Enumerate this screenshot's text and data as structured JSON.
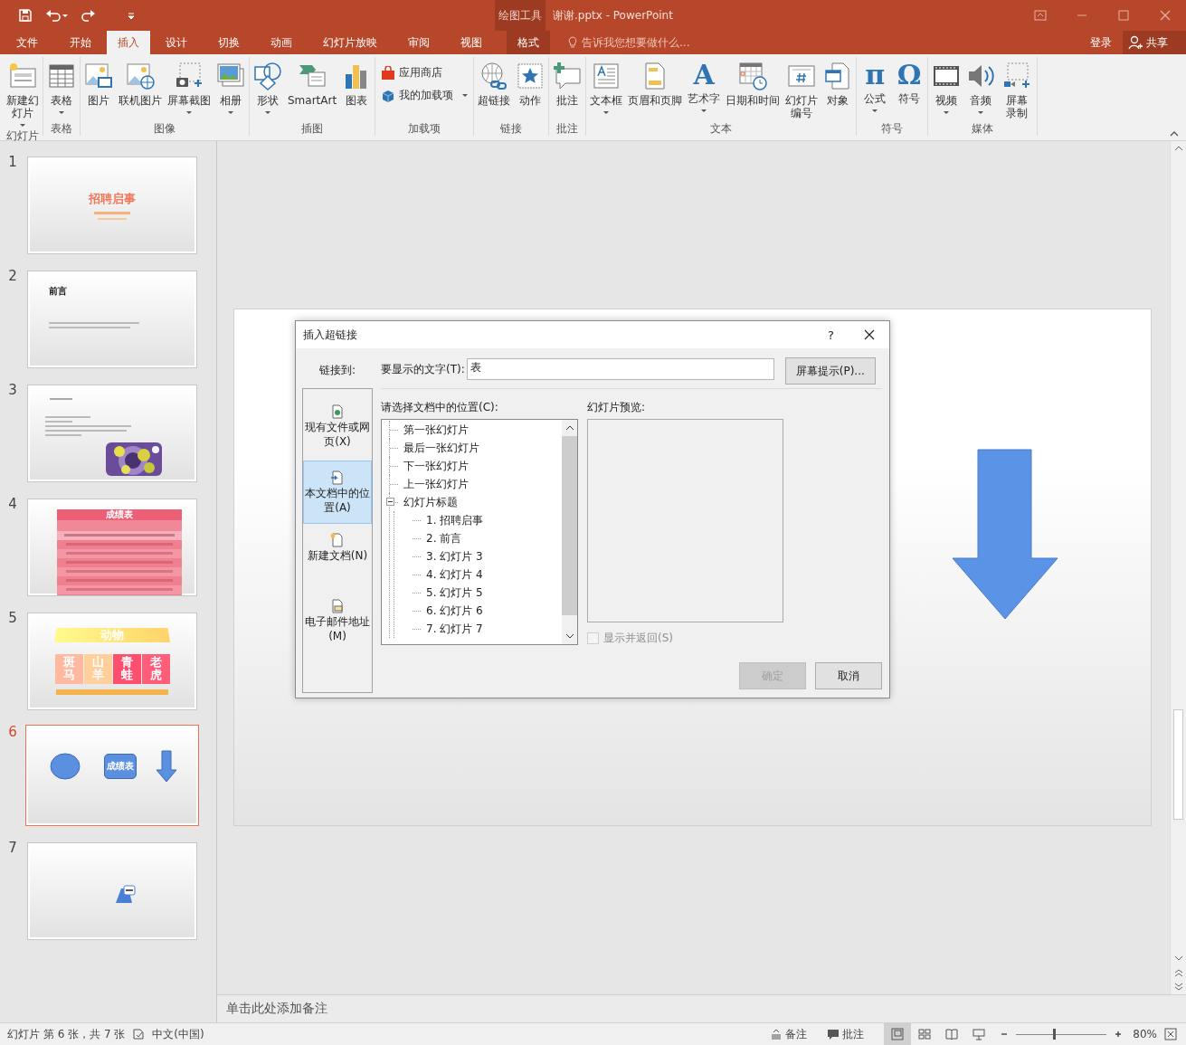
{
  "window": {
    "context_group": "绘图工具",
    "title": "谢谢.pptx - PowerPoint"
  },
  "tabs": [
    {
      "label": "文件",
      "kind": "file",
      "selected": false
    },
    {
      "label": "开始",
      "kind": "normal",
      "selected": false
    },
    {
      "label": "插入",
      "kind": "normal",
      "selected": true
    },
    {
      "label": "设计",
      "kind": "normal",
      "selected": false
    },
    {
      "label": "切换",
      "kind": "normal",
      "selected": false
    },
    {
      "label": "动画",
      "kind": "normal",
      "selected": false
    },
    {
      "label": "幻灯片放映",
      "kind": "normal",
      "selected": false
    },
    {
      "label": "审阅",
      "kind": "normal",
      "selected": false
    },
    {
      "label": "视图",
      "kind": "normal",
      "selected": false
    },
    {
      "label": "格式",
      "kind": "context",
      "selected": false
    }
  ],
  "tell_me": "告诉我您想要做什么...",
  "sign_in": "登录",
  "share": "共享",
  "ribbon": {
    "groups": [
      {
        "label": "幻灯片",
        "kind": "large",
        "items": [
          {
            "label": "新建幻灯片",
            "dropdown": true,
            "wrap": true
          }
        ]
      },
      {
        "label": "表格",
        "kind": "large",
        "items": [
          {
            "label": "表格",
            "dropdown": true
          }
        ]
      },
      {
        "label": "图像",
        "kind": "large",
        "items": [
          {
            "label": "图片",
            "dropdown": false
          },
          {
            "label": "联机图片",
            "dropdown": false
          },
          {
            "label": "屏幕截图",
            "dropdown": true
          },
          {
            "label": "相册",
            "dropdown": true
          }
        ]
      },
      {
        "label": "插图",
        "kind": "large",
        "items": [
          {
            "label": "形状",
            "dropdown": true
          },
          {
            "label": "SmartArt",
            "dropdown": false
          },
          {
            "label": "图表",
            "dropdown": false
          }
        ]
      },
      {
        "label": "加载项",
        "kind": "small",
        "items": [
          {
            "label": "应用商店",
            "dropdown": false
          },
          {
            "label": "我的加载项",
            "dropdown": true
          }
        ]
      },
      {
        "label": "链接",
        "kind": "large",
        "items": [
          {
            "label": "超链接",
            "dropdown": false
          },
          {
            "label": "动作",
            "dropdown": false
          }
        ]
      },
      {
        "label": "批注",
        "kind": "large",
        "items": [
          {
            "label": "批注",
            "dropdown": false
          }
        ]
      },
      {
        "label": "文本",
        "kind": "large",
        "items": [
          {
            "label": "文本框",
            "dropdown": true
          },
          {
            "label": "页眉和页脚",
            "dropdown": false
          },
          {
            "label": "艺术字",
            "dropdown": true,
            "glyph": "A"
          },
          {
            "label": "日期和时间",
            "dropdown": false
          },
          {
            "label": "幻灯片编号",
            "dropdown": false,
            "wrap": true
          },
          {
            "label": "对象",
            "dropdown": false
          }
        ]
      },
      {
        "label": "符号",
        "kind": "large",
        "items": [
          {
            "label": "公式",
            "dropdown": true,
            "glyph": "π"
          },
          {
            "label": "符号",
            "dropdown": false,
            "glyph": "Ω"
          }
        ]
      },
      {
        "label": "媒体",
        "kind": "large",
        "items": [
          {
            "label": "视频",
            "dropdown": true
          },
          {
            "label": "音频",
            "dropdown": true
          },
          {
            "label": "屏幕录制",
            "dropdown": false,
            "wrap": true
          }
        ]
      }
    ]
  },
  "slides": [
    {
      "number": "1",
      "selected": false,
      "kind": "title",
      "title": "招聘启事"
    },
    {
      "number": "2",
      "selected": false,
      "kind": "text",
      "title": "前言"
    },
    {
      "number": "3",
      "selected": false,
      "kind": "text-picture"
    },
    {
      "number": "4",
      "selected": false,
      "kind": "table",
      "title": "成绩表"
    },
    {
      "number": "5",
      "selected": false,
      "kind": "tiles",
      "title": "动物",
      "tiles": [
        "斑马",
        "山羊",
        "青蛙",
        "老虎"
      ]
    },
    {
      "number": "6",
      "selected": true,
      "kind": "shapes",
      "label": "成绩表"
    },
    {
      "number": "7",
      "selected": false,
      "kind": "badge"
    }
  ],
  "notes_placeholder": "单击此处添加备注",
  "dialog": {
    "title": "插入超链接",
    "help": "?",
    "link_to_label": "链接到:",
    "link_targets": [
      {
        "label": "现有文件或网页(X)",
        "selected": false
      },
      {
        "label": "本文档中的位置(A)",
        "selected": true
      },
      {
        "label": "新建文档(N)",
        "selected": false
      },
      {
        "label": "电子邮件地址(M)",
        "selected": false
      }
    ],
    "display_text": {
      "label": "要显示的文字(T):",
      "value": "表"
    },
    "screentip_button": "屏幕提示(P)...",
    "location_label": "请选择文档中的位置(C):",
    "tree": [
      {
        "label": "第一张幻灯片"
      },
      {
        "label": "最后一张幻灯片"
      },
      {
        "label": "下一张幻灯片"
      },
      {
        "label": "上一张幻灯片"
      },
      {
        "label": "幻灯片标题",
        "expanded": true,
        "children": [
          {
            "label": "1. 招聘启事"
          },
          {
            "label": "2. 前言"
          },
          {
            "label": "3. 幻灯片 3"
          },
          {
            "label": "4. 幻灯片 4"
          },
          {
            "label": "5. 幻灯片 5"
          },
          {
            "label": "6. 幻灯片 6"
          },
          {
            "label": "7. 幻灯片 7"
          }
        ]
      }
    ],
    "preview_label": "幻灯片预览:",
    "show_and_return": {
      "label": "显示并返回(S)",
      "checked": false,
      "disabled": true
    },
    "buttons": [
      {
        "label": "确定",
        "disabled": true
      },
      {
        "label": "取消",
        "disabled": false
      }
    ]
  },
  "status_bar": {
    "slide_info": "幻灯片 第 6 张，共 7 张",
    "language": "中文(中国)",
    "notes": "备注",
    "comments": "批注",
    "views": [
      {
        "selected": true
      },
      {
        "selected": false
      },
      {
        "selected": false
      },
      {
        "selected": false
      }
    ],
    "zoom": {
      "level": 0.42,
      "reading": "80%"
    }
  }
}
